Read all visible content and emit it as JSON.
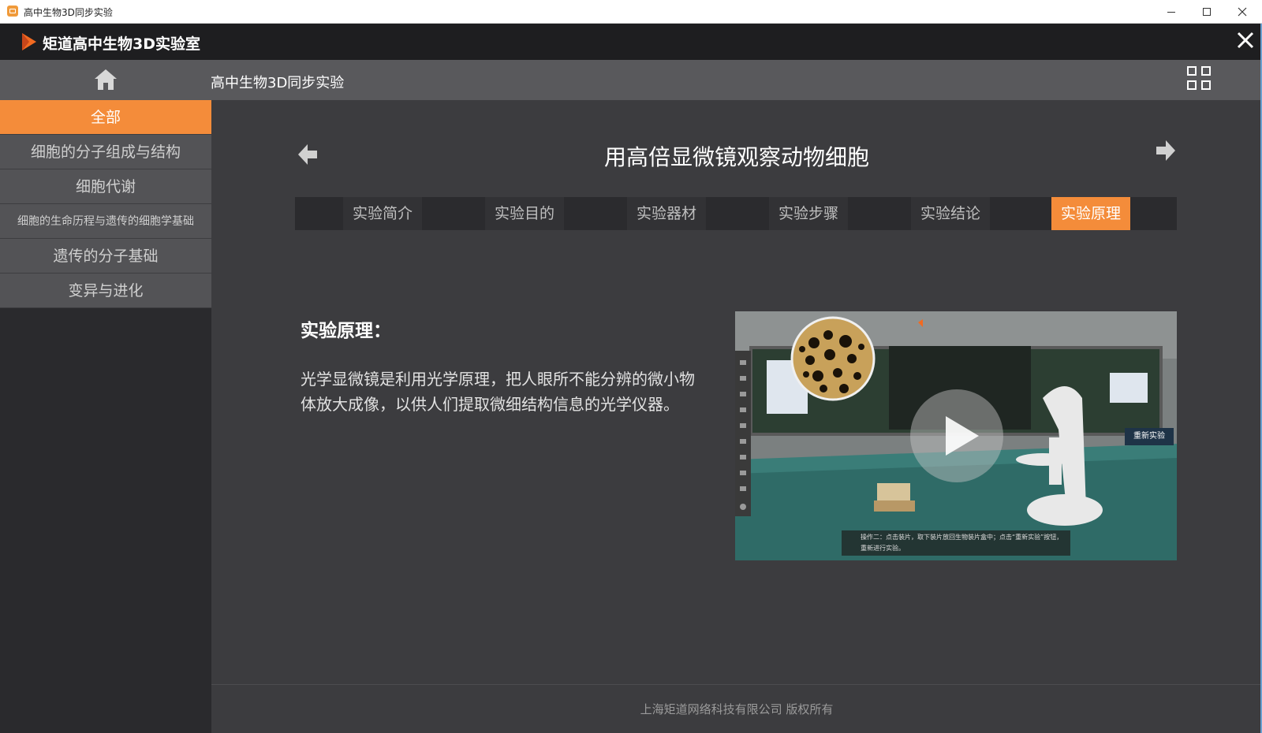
{
  "window": {
    "title": "高中生物3D同步实验"
  },
  "header": {
    "app_name": "矩道高中生物3D实验室"
  },
  "nav": {
    "title": "高中生物3D同步实验"
  },
  "sidebar": {
    "items": [
      {
        "label": "全部",
        "active": true
      },
      {
        "label": "细胞的分子组成与结构"
      },
      {
        "label": "细胞代谢"
      },
      {
        "label": "细胞的生命历程与遗传的细胞学基础"
      },
      {
        "label": "遗传的分子基础"
      },
      {
        "label": "变异与进化"
      }
    ]
  },
  "experiment": {
    "title": "用高倍显微镜观察动物细胞",
    "tabs": [
      {
        "label": "实验简介"
      },
      {
        "label": "实验目的"
      },
      {
        "label": "实验器材"
      },
      {
        "label": "实验步骤"
      },
      {
        "label": "实验结论"
      },
      {
        "label": "实验原理",
        "active": true
      }
    ],
    "principle_heading": "实验原理：",
    "principle_text": "光学显微镜是利用光学原理，把人眼所不能分辨的微小物体放大成像，以供人们提取微细结构信息的光学仪器。"
  },
  "video": {
    "board_title": "用高倍显微镜观察动物细胞",
    "restart_label": "重新实验",
    "caption": "操作二：点击装片，取下装片放回生物装片盒中；点击“重新实验”按钮，重新进行实验。"
  },
  "footer": {
    "copyright": "上海矩道网络科技有限公司  版权所有"
  },
  "colors": {
    "accent": "#f48c3a",
    "header_bg": "#1e1e20",
    "nav_bg": "#59595c",
    "main_bg": "#3c3c3f"
  }
}
